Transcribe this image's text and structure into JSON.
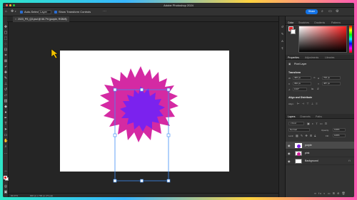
{
  "app": {
    "title": "Adobe Photoshop 2024",
    "traffic_colors": [
      "#ff5f57",
      "#febc2e",
      "#28c840"
    ]
  },
  "options_bar": {
    "auto_select_label": "Auto-Select:",
    "auto_select_value": "Layer",
    "show_transform_label": "Show Transform Controls",
    "share_label": "Share"
  },
  "document": {
    "tab_label": "2023_PS_Q3.psd @ 66.7% (purple, RGB/8)",
    "close_glyph": "×"
  },
  "status": {
    "zoom": "66.67%",
    "doc_size": "900 px x 700 px (72 ppi)"
  },
  "panels": {
    "color_tabs": [
      "Color",
      "Swatches",
      "Gradients",
      "Patterns"
    ],
    "properties_tabs": [
      "Properties",
      "Adjustments",
      "Libraries"
    ],
    "layer_type": "Pixel Layer",
    "transform_heading": "Transform",
    "transform": {
      "w_label": "W",
      "w": "465 px",
      "h_label": "H",
      "h": "700 px",
      "x_label": "X",
      "x": "360 px",
      "y_label": "Y",
      "y": "487 px",
      "angle": "0.00°"
    },
    "align_heading": "Align and Distribute",
    "align_label": "Align:",
    "layers_tabs": [
      "Layers",
      "Channels",
      "Paths"
    ],
    "kind_label": "Kind",
    "blend_mode": "Normal",
    "opacity_label": "Opacity:",
    "opacity": "100%",
    "lock_label": "Lock:",
    "fill_label": "Fill:",
    "fill": "100%",
    "layers": [
      {
        "name": "purple",
        "selected": true,
        "thumb": "#7a1fe6"
      },
      {
        "name": "pink",
        "selected": false,
        "thumb": "#d4229c"
      },
      {
        "name": "Background",
        "selected": false,
        "thumb": "#ffffff"
      }
    ]
  },
  "colors": {
    "pink": "#d42aa3",
    "purple": "#7b22ee",
    "accent": "#1473e6",
    "foreground_swatch": "#e2232a"
  }
}
